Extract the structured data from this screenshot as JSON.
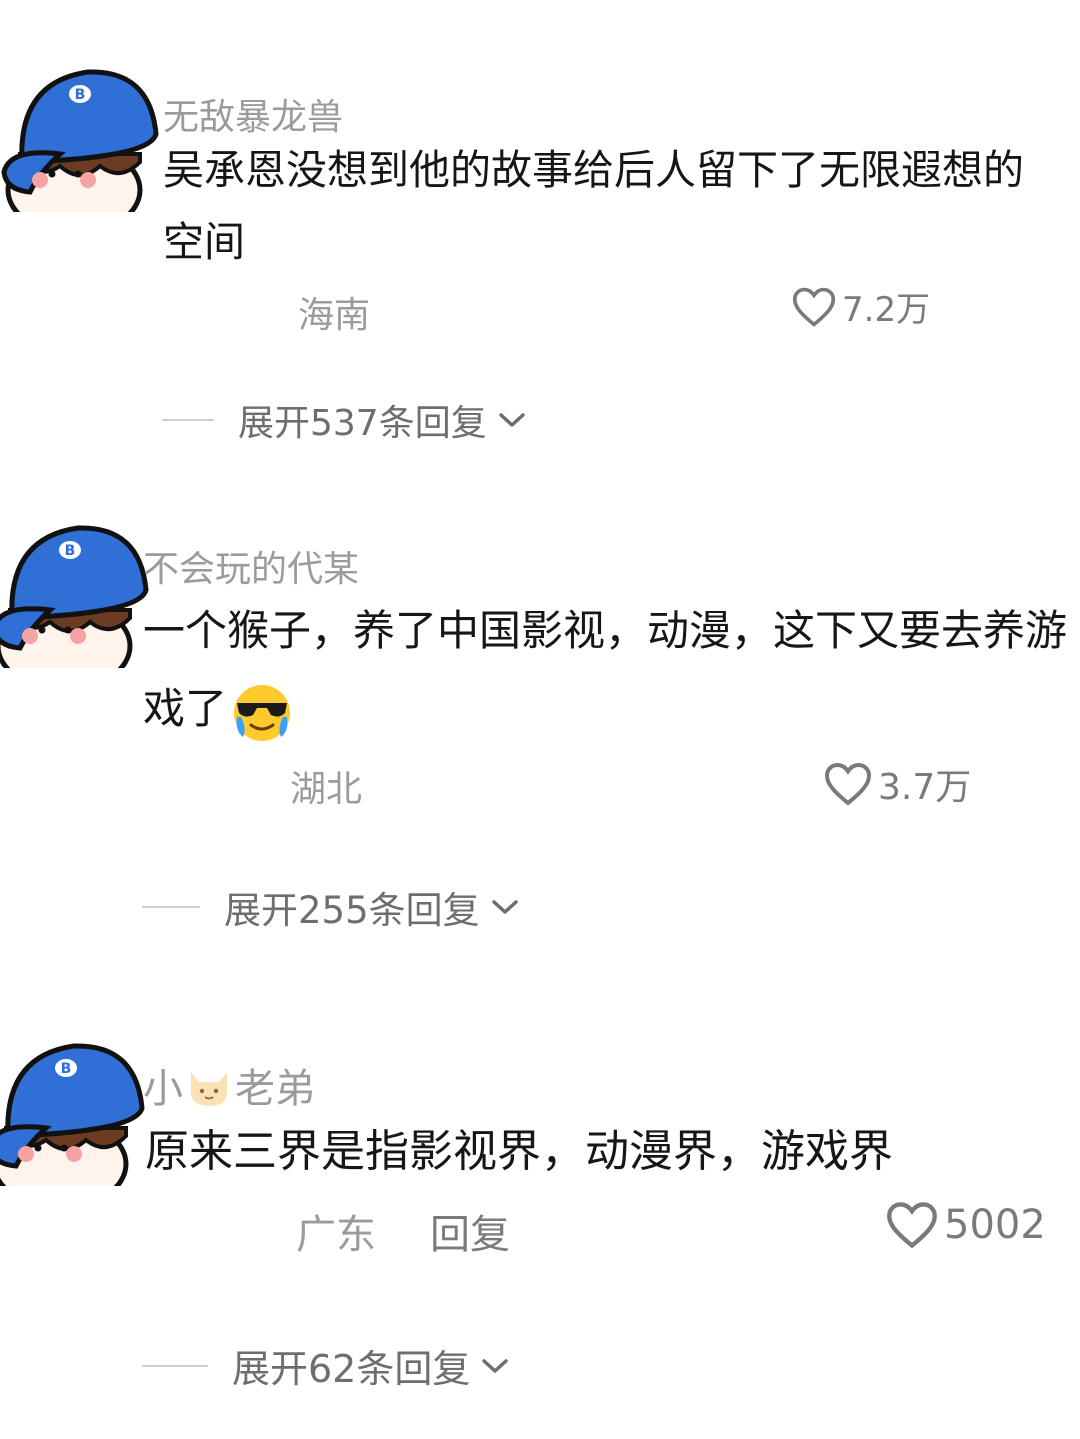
{
  "comments": [
    {
      "username": "无敌暴龙兽",
      "text": "吴承恩没想到他的故事给后人留下了无限遐想的空间",
      "location": "海南",
      "likes": "7.2万",
      "expand": "展开537条回复"
    },
    {
      "username": "不会玩的代某",
      "text": "一个猴子，养了中国影视，动漫，这下又要去养游戏了",
      "location": "湖北",
      "likes": "3.7万",
      "expand": "展开255条回复"
    },
    {
      "username_part1": "小",
      "username_part2": "老弟",
      "text": "原来三界是指影视界，动漫界，游戏界",
      "location": "广东",
      "reply": "回复",
      "likes": "5002",
      "expand": "展开62条回复"
    }
  ],
  "icons": {
    "avatar": "cartoon-boy-blue-cap-avatar-icon",
    "like": "heart-outline-icon",
    "expand": "chevron-down-icon",
    "emoji": "crying-sunglasses-emoji-icon",
    "cat": "cat-face-emoji-icon"
  },
  "colors": {
    "cap": "#2f6fd6",
    "text": "#161616",
    "muted": "#9b9b9b"
  }
}
